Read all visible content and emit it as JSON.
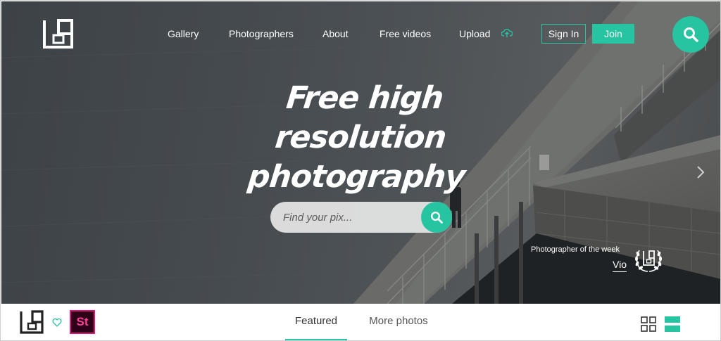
{
  "brand": {
    "accent": "#26c4a0"
  },
  "nav": {
    "items": [
      {
        "label": "Gallery"
      },
      {
        "label": "Photographers"
      },
      {
        "label": "About"
      },
      {
        "label": "Free videos"
      },
      {
        "label": "Upload"
      }
    ],
    "signin_label": "Sign In",
    "join_label": "Join",
    "search_icon": "search-icon"
  },
  "hero": {
    "headline_line1": "Free high resolution",
    "headline_line2": "photography",
    "search": {
      "placeholder": "Find your pix...",
      "value": ""
    },
    "next_icon": "chevron-right-icon"
  },
  "photographer_of_week": {
    "label": "Photographer of the week",
    "name": "Vio"
  },
  "bottom_bar": {
    "tabs": [
      {
        "label": "Featured",
        "active": true
      },
      {
        "label": "More photos",
        "active": false
      }
    ],
    "stock_badge": "St",
    "view_icons": [
      "grid-view-icon",
      "list-view-icon"
    ]
  }
}
